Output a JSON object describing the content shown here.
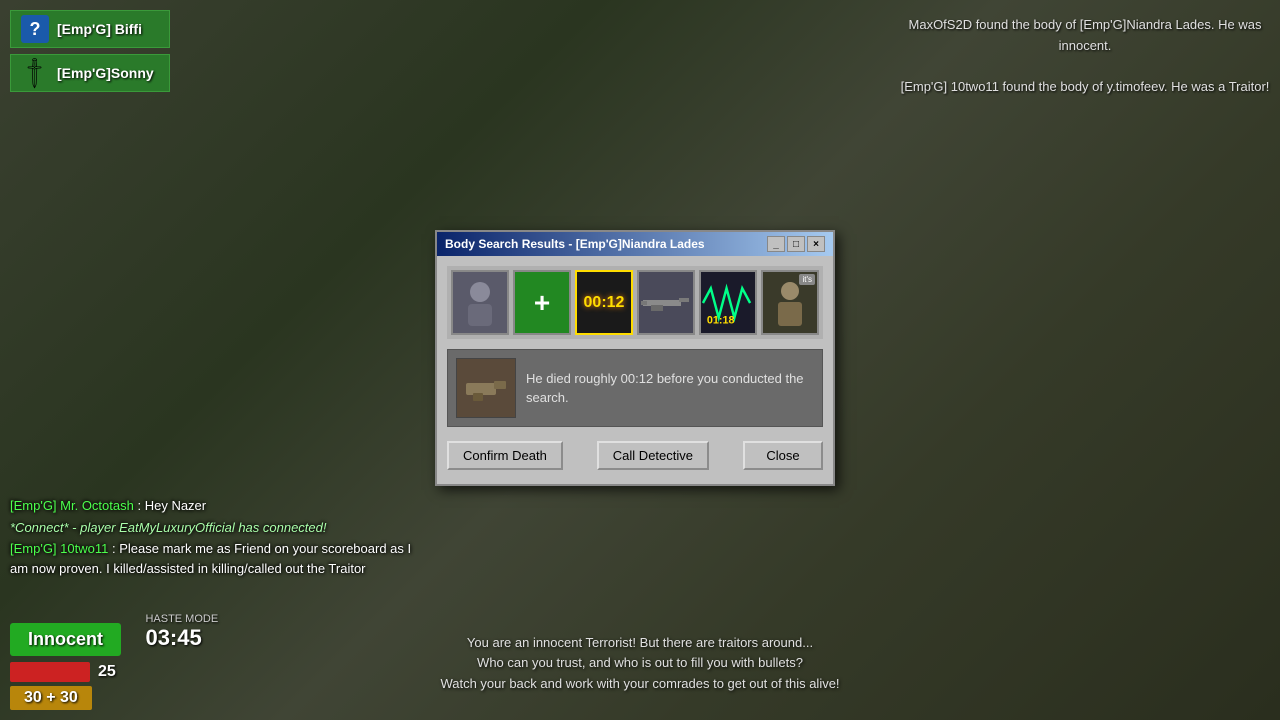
{
  "game": {
    "background_color": "#2d3520"
  },
  "notifications": {
    "line1": "MaxOfS2D found the body of [Emp'G]Niandra Lades. He was innocent.",
    "line2": "[Emp'G] 10two11 found the body of y.timofeev. He was a Traitor!"
  },
  "players": [
    {
      "name": "[Emp'G] Biffi",
      "icon_type": "question",
      "id": "biffi"
    },
    {
      "name": "[Emp'G]Sonny",
      "icon_type": "knife",
      "id": "sonny"
    }
  ],
  "chat": [
    {
      "type": "player",
      "player": "[Emp'G] Mr. Octotash",
      "text": ": Hey Nazer"
    },
    {
      "type": "connect",
      "text": "*Connect* - player EatMyLuxuryOfficial has connected!"
    },
    {
      "type": "player",
      "player": "[Emp'G] 10two11",
      "text": ": Please mark me as Friend on your scoreboard as I am now proven. I killed/assisted in killing/called out the Traitor"
    }
  ],
  "hud": {
    "role": "Innocent",
    "haste_label": "HASTE MODE",
    "haste_time": "03:45",
    "health": "25",
    "ammo": "30 + 30"
  },
  "bottom_text": {
    "line1": "You are an innocent Terrorist! But there are traitors around...",
    "line2": "Who can you trust, and who is out to fill you with bullets?",
    "line3": "Watch your back and work with your comrades to get out of this alive!"
  },
  "dialog": {
    "title": "Body Search Results - [Emp'G]Niandra Lades",
    "titlebar_buttons": [
      "_",
      "□",
      "×"
    ],
    "icons": [
      {
        "type": "player",
        "label": "player-avatar",
        "selected": false
      },
      {
        "type": "health",
        "label": "health-icon",
        "selected": false
      },
      {
        "type": "time",
        "text": "00:12",
        "label": "time-of-death",
        "selected": true
      },
      {
        "type": "weapon",
        "label": "weapon-icon",
        "selected": false
      },
      {
        "type": "dna",
        "text": "01:18",
        "label": "dna-icon",
        "selected": false
      },
      {
        "type": "suspect",
        "label": "suspect-icon",
        "badge": "it's",
        "selected": false
      }
    ],
    "info_text": "He died roughly 00:12 before you conducted the search.",
    "buttons": {
      "confirm_death": "Confirm Death",
      "call_detective": "Call Detective",
      "close": "Close"
    }
  }
}
